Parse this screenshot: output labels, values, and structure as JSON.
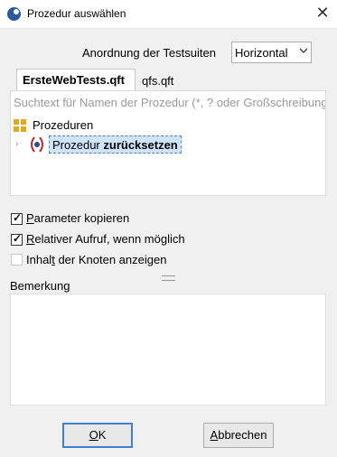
{
  "window": {
    "title": "Prozedur auswählen",
    "close_glyph": "✕"
  },
  "ordering": {
    "label": "Anordnung der Testsuiten",
    "selected": "Horizontal"
  },
  "tabs": [
    {
      "label": "ErsteWebTests.qft",
      "active": true
    },
    {
      "label": "qfs.qft",
      "active": false
    }
  ],
  "tree": {
    "search_placeholder": "Suchtext für Namen der Prozedur (*, ? oder Großschreibung)",
    "root": {
      "label": "Prozeduren",
      "icon": "procedures-folder-icon"
    },
    "item": {
      "prefix": "Prozedur",
      "name": "zurücksetzen",
      "icon": "procedure-icon"
    }
  },
  "options": [
    {
      "first": "P",
      "rest": "arameter kopieren",
      "checked": true
    },
    {
      "first": "R",
      "rest": "elativer Aufruf, wenn möglich",
      "checked": true
    },
    {
      "pre": "Inhal",
      "first": "t",
      "rest": " der Knoten anzeigen",
      "checked": false
    }
  ],
  "notes": {
    "label": "Bemerkung"
  },
  "buttons": {
    "ok": {
      "first": "O",
      "rest": "K"
    },
    "cancel": {
      "first": "A",
      "rest": "bbrechen"
    }
  },
  "colors": {
    "selection": "#cfe3fb",
    "default_button_border": "#3d7fd0",
    "app_icon": "#2a5a9c"
  }
}
